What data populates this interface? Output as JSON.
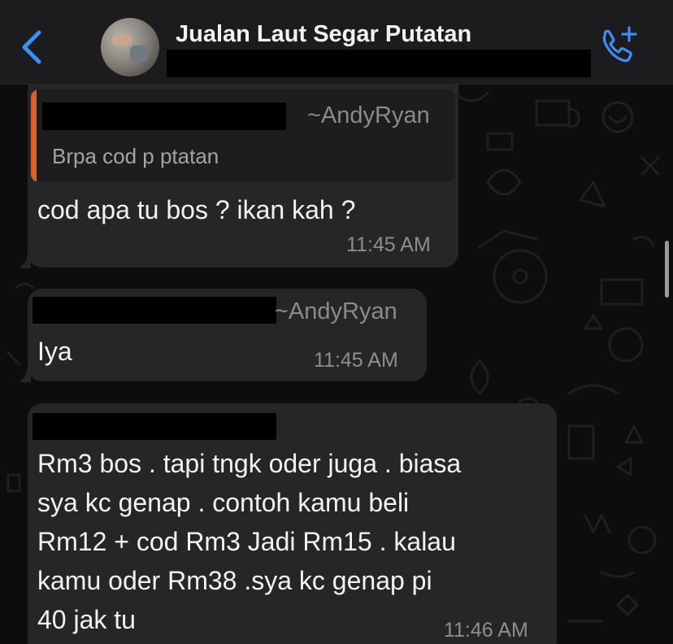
{
  "header": {
    "back_icon": "chevron-left-icon",
    "avatar": "group-avatar",
    "title": "Jualan Laut Segar Putatan",
    "call_icon": "add-call-icon",
    "accent_color": "#3d8ef7"
  },
  "messages": [
    {
      "quote": {
        "author": "~AndyRyan",
        "text": "Brpa cod p ptatan",
        "bar_color": "#d8622c"
      },
      "text": "cod apa tu bos ? ikan kah ?",
      "time": "11:45 AM"
    },
    {
      "author": "~AndyRyan",
      "text": "Iya",
      "time": "11:45 AM"
    },
    {
      "lines": [
        "Rm3 bos . tapi tngk oder juga . biasa",
        "sya kc genap . contoh kamu beli",
        "Rm12 + cod Rm3 Jadi Rm15 . kalau",
        "kamu oder Rm38 .sya kc genap pi",
        "40 jak tu"
      ],
      "time": "11:46 AM"
    }
  ]
}
